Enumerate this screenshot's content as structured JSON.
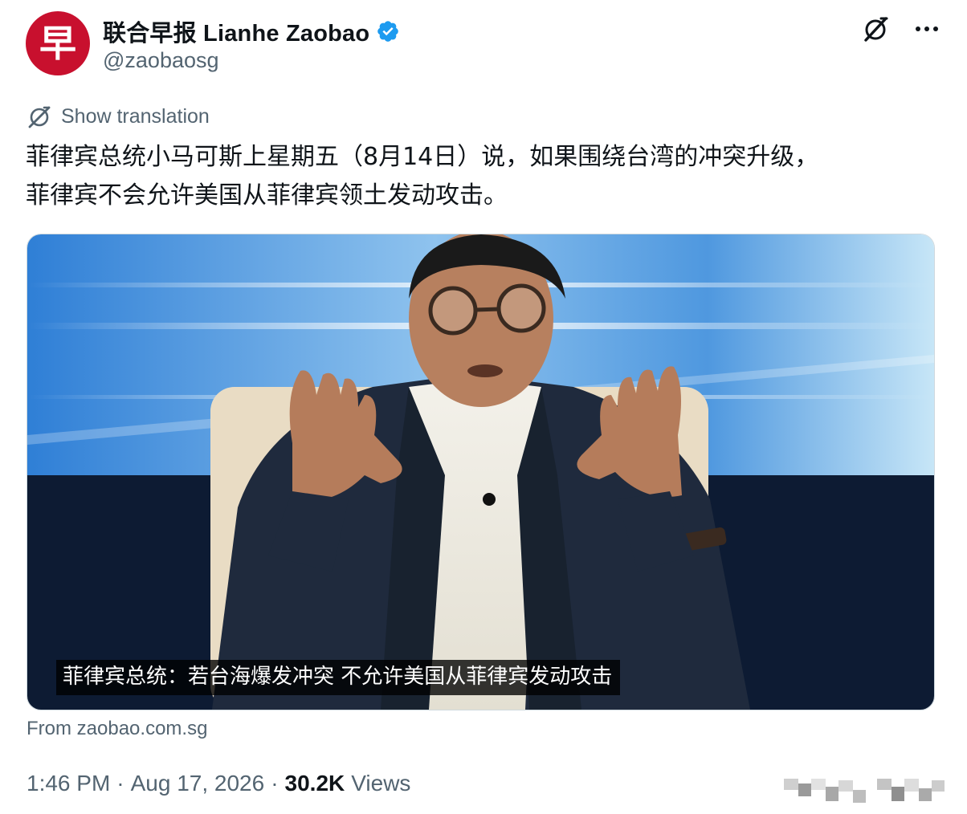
{
  "author": {
    "display_name": "联合早报 Lianhe Zaobao",
    "handle": "@zaobaosg",
    "avatar_glyph": "早",
    "avatar_color": "#c8102e",
    "verified_color": "#1d9bf0"
  },
  "actions": {
    "grok_icon": "grok-icon",
    "more_label": "···"
  },
  "translation": {
    "label": "Show translation",
    "icon": "globe-icon"
  },
  "tweet": {
    "line1": "菲律宾总统小马可斯上星期五（8月14日）说，如果围绕台湾的冲突升级，",
    "line2": "菲律宾不会允许美国从菲律宾领土发动攻击。"
  },
  "media": {
    "caption": "菲律宾总统：若台海爆发冲突 不允许美国从菲律宾发动攻击"
  },
  "source": {
    "label": "From zaobao.com.sg"
  },
  "meta": {
    "time": "1:46 PM",
    "separator": "·",
    "date": "Aug 17, 2026",
    "views_count": "30.2K",
    "views_label": "Views"
  }
}
